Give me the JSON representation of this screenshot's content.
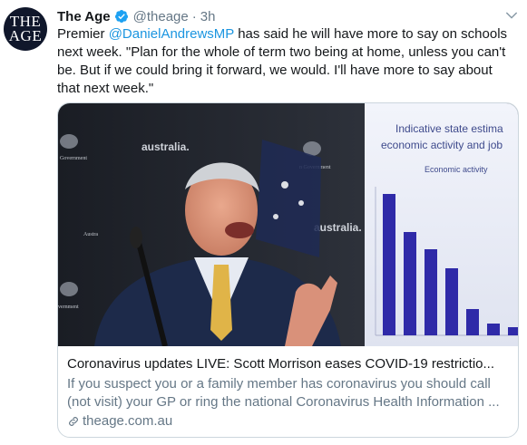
{
  "tweet": {
    "avatar": {
      "line1": "THE",
      "line2": "AGE"
    },
    "name": "The Age",
    "handle": "@theage",
    "separator": "·",
    "time": "3h",
    "body": {
      "pre": "Premier ",
      "mention": "@DanielAndrewsMP",
      "post": " has said he will have more to say on schools next week. \"Plan for the whole of term two being at home, unless you can't be. But if we could bring it forward, we would. I'll have more to say about that next week.\""
    }
  },
  "card": {
    "title": "Coronavirus updates LIVE: Scott Morrison eases COVID-19 restrictio...",
    "description": "If you suspect you or a family member has coronavirus you should call (not visit) your GP or ring the national Coronavirus Health Information ...",
    "domain": "theage.com.au",
    "image": {
      "backdrop_text_1": "australia.",
      "backdrop_text_2": "australia.",
      "backdrop_text_3": "Government",
      "backdrop_text_4": "n Government",
      "backdrop_text_5": "Austra",
      "backdrop_text_6": "vernment",
      "screen_title_1": "Indicative state estima",
      "screen_title_2": "economic activity and job",
      "screen_chart_label": "Economic activity"
    }
  },
  "colors": {
    "link": "#1b95e0",
    "muted": "#657786",
    "verified": "#1da1f2"
  }
}
